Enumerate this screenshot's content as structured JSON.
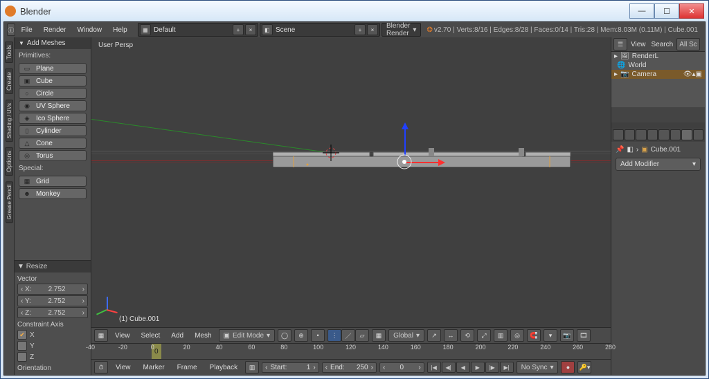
{
  "window": {
    "title": "Blender"
  },
  "top_menu": {
    "items": [
      "File",
      "Render",
      "Window",
      "Help"
    ],
    "layout": "Default",
    "scene": "Scene",
    "engine": "Blender Render",
    "stats": "v2.70 | Verts:8/16 | Edges:8/28 | Faces:0/14 | Tris:28 | Mem:8.03M (0.11M) | Cube.001"
  },
  "left_tabs": [
    "Tools",
    "Create",
    "Shading / UVs",
    "Options",
    "Grease Pencil"
  ],
  "tool_shelf": {
    "add_meshes_header": "Add Meshes",
    "primitives_label": "Primitives:",
    "primitives": [
      "Plane",
      "Cube",
      "Circle",
      "UV Sphere",
      "Ico Sphere",
      "Cylinder",
      "Cone",
      "Torus"
    ],
    "special_label": "Special:",
    "special": [
      "Grid",
      "Monkey"
    ]
  },
  "op_panel": {
    "header": "Resize",
    "vector_label": "Vector",
    "x_label": "X:",
    "x_val": "2.752",
    "y_label": "Y:",
    "y_val": "2.752",
    "z_label": "Z:",
    "z_val": "2.752",
    "constraint_label": "Constraint Axis",
    "axis_x": "X",
    "axis_y": "Y",
    "axis_z": "Z",
    "orientation_label": "Orientation"
  },
  "viewport": {
    "view_label": "User Persp",
    "object_label": "(1) Cube.001"
  },
  "view_header": {
    "menus": [
      "View",
      "Select",
      "Add",
      "Mesh"
    ],
    "mode": "Edit Mode",
    "orientation": "Global"
  },
  "ruler": {
    "ticks": [
      -40,
      -20,
      0,
      20,
      40,
      60,
      80,
      100,
      120,
      140,
      160,
      180,
      200,
      220,
      240,
      260,
      280
    ]
  },
  "timeline": {
    "menus": [
      "View",
      "Marker",
      "Frame",
      "Playback"
    ],
    "start_label": "Start:",
    "start_val": "1",
    "end_label": "End:",
    "end_val": "250",
    "cur_val": "0",
    "sync": "No Sync"
  },
  "outliner": {
    "view_btn": "View",
    "search_btn": "Search",
    "filter_btn": "All Sc",
    "items": [
      "RenderL",
      "World",
      "Camera"
    ]
  },
  "properties": {
    "object_name": "Cube.001",
    "add_modifier": "Add Modifier"
  },
  "icons": {
    "plane": "▭",
    "cube": "▣",
    "circle": "○",
    "uvsphere": "◉",
    "icosphere": "◈",
    "cylinder": "▯",
    "cone": "△",
    "torus": "◎",
    "grid": "▦",
    "monkey": "☻"
  }
}
